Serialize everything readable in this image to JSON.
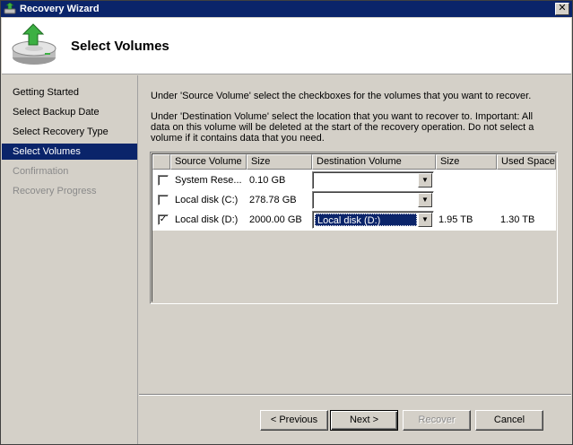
{
  "window": {
    "title": "Recovery Wizard"
  },
  "header": {
    "title": "Select Volumes"
  },
  "sidebar": {
    "items": [
      {
        "label": "Getting Started",
        "state": "normal"
      },
      {
        "label": "Select Backup Date",
        "state": "normal"
      },
      {
        "label": "Select Recovery Type",
        "state": "normal"
      },
      {
        "label": "Select Volumes",
        "state": "active"
      },
      {
        "label": "Confirmation",
        "state": "disabled"
      },
      {
        "label": "Recovery Progress",
        "state": "disabled"
      }
    ]
  },
  "content": {
    "instruction1": "Under 'Source Volume' select the checkboxes for the volumes that you want to recover.",
    "instruction2_line1": "Under 'Destination Volume' select the location that you want to recover to. Important: All",
    "instruction2_line2": "data on this volume will be deleted at the start of the recovery operation. Do not select a",
    "instruction2_line3": "volume if it contains data that you need."
  },
  "table": {
    "columns": [
      "Source Volume",
      "Size",
      "Destination Volume",
      "Size",
      "Used Space"
    ],
    "rows": [
      {
        "checked": false,
        "source": "System Rese...",
        "size": "0.10 GB",
        "destination": "",
        "dest_size": "",
        "used": ""
      },
      {
        "checked": false,
        "source": "Local disk (C:)",
        "size": "278.78 GB",
        "destination": "",
        "dest_size": "",
        "used": ""
      },
      {
        "checked": true,
        "source": "Local disk (D:)",
        "size": "2000.00 GB",
        "destination": "Local disk (D:)",
        "dest_size": "1.95 TB",
        "used": "1.30 TB"
      }
    ]
  },
  "buttons": {
    "previous": "< Previous",
    "next": "Next >",
    "recover": "Recover",
    "cancel": "Cancel"
  },
  "icons": {
    "title": "recovery-wizard-icon",
    "header": "disk-restore-icon",
    "close": "close-icon",
    "dropdown": "chevron-down-icon",
    "check": "check-icon"
  },
  "colors": {
    "titlebar": "#0a246a",
    "selection": "#0a246a",
    "face": "#d4d0c8"
  }
}
